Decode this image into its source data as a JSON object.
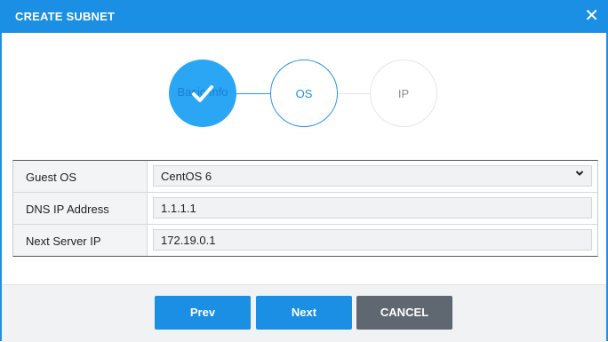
{
  "dialog": {
    "title": "CREATE SUBNET",
    "close_glyph": "✕"
  },
  "steps": [
    {
      "label": "Basic Info",
      "state": "completed"
    },
    {
      "label": "OS",
      "state": "active"
    },
    {
      "label": "IP",
      "state": "pending"
    }
  ],
  "form": {
    "guest_os": {
      "label": "Guest OS",
      "value": "CentOS 6"
    },
    "dns_ip": {
      "label": "DNS IP Address",
      "value": "1.1.1.1"
    },
    "next_server_ip": {
      "label": "Next Server IP",
      "value": "172.19.0.1"
    }
  },
  "buttons": {
    "prev": "Prev",
    "next": "Next",
    "cancel": "CANCEL"
  },
  "colors": {
    "accent": "#1a8fe3",
    "cancel": "#5f6871",
    "step_done": "#2aa6f5"
  },
  "icons": {
    "close": "close-icon",
    "check": "check-icon",
    "dropdown": "chevron-down-icon"
  }
}
